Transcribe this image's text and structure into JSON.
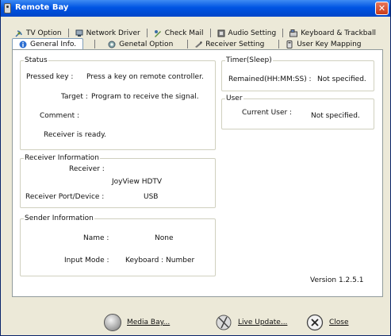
{
  "window": {
    "title": "Remote Bay"
  },
  "tabs_row1": [
    {
      "label": "TV Option",
      "icon": "satellite-icon"
    },
    {
      "label": "Network Driver",
      "icon": "network-icon"
    },
    {
      "label": "Check Mail",
      "icon": "mail-icon"
    },
    {
      "label": "Audio Setting",
      "icon": "audio-icon"
    },
    {
      "label": "Keyboard & Trackball",
      "icon": "keyboard-icon"
    }
  ],
  "tabs_row2": [
    {
      "label": "General Info.",
      "icon": "info-icon",
      "active": true
    },
    {
      "label": "Genetal Option",
      "icon": "gear-icon"
    },
    {
      "label": "Receiver Setting",
      "icon": "receiver-icon"
    },
    {
      "label": "User Key Mapping",
      "icon": "keymap-icon"
    }
  ],
  "status": {
    "legend": "Status",
    "pressed_key_label": "Pressed key :",
    "pressed_key_value": "Press a key on remote controller.",
    "target_label": "Target :",
    "target_value": "Program to receive the signal.",
    "comment_label": "Comment :",
    "message": "Receiver is ready."
  },
  "timer": {
    "legend": "Timer(Sleep)",
    "remained_label": "Remained(HH:MM:SS) :",
    "remained_value": "Not specified."
  },
  "user": {
    "legend": "User",
    "current_label": "Current User :",
    "current_value": "Not specified."
  },
  "receiver_info": {
    "legend": "Receiver Information",
    "receiver_label": "Receiver :",
    "receiver_value": "JoyView HDTV",
    "port_label": "Receiver Port/Device :",
    "port_value": "USB"
  },
  "sender_info": {
    "legend": "Sender Information",
    "name_label": "Name :",
    "name_value": "None",
    "input_mode_label": "Input Mode :",
    "input_mode_value": "Keyboard : Number"
  },
  "version": "Version 1.2.5.1",
  "buttons": {
    "media_bay": "Media Bay...",
    "live_update": "Live Update...",
    "close": "Close"
  }
}
